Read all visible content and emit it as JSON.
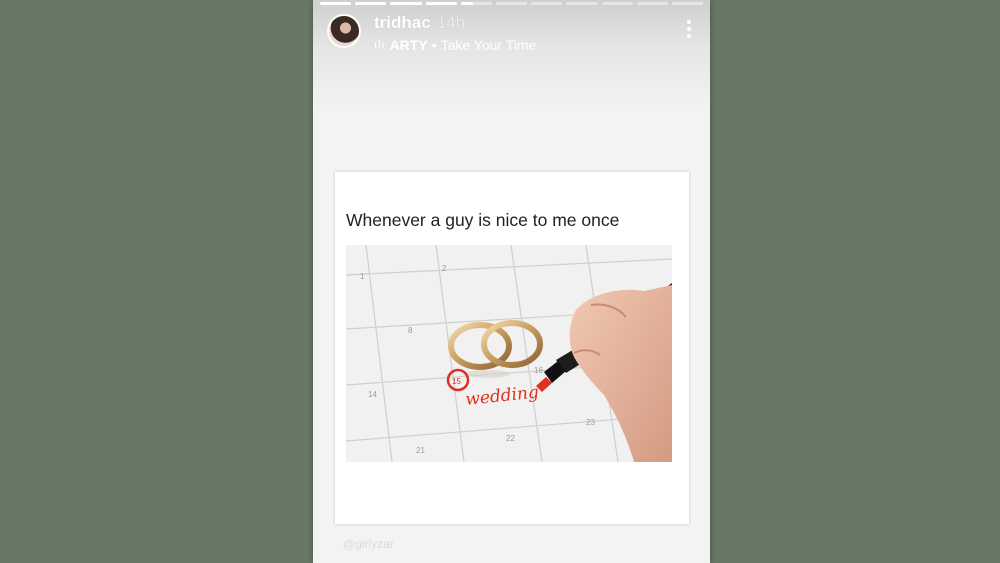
{
  "story": {
    "progress": [
      1,
      1,
      1,
      1,
      0.4,
      0,
      0,
      0,
      0,
      0,
      0
    ],
    "username": "tridhac",
    "time": "14h",
    "music_icon": "music-bars-icon",
    "music_artist": "ARTY",
    "music_separator": "•",
    "music_song": "Take Your Time",
    "more_icon": "vertical-dots-icon"
  },
  "post": {
    "caption": "Whenever a guy is nice to me once",
    "calendar_numbers": [
      "1",
      "2",
      "8",
      "14",
      "15",
      "16",
      "22",
      "23",
      "21"
    ],
    "written_word": "wedding",
    "watermark": "@girlyzar"
  },
  "colors": {
    "background": "#697864",
    "marker_red": "#e0301e"
  }
}
